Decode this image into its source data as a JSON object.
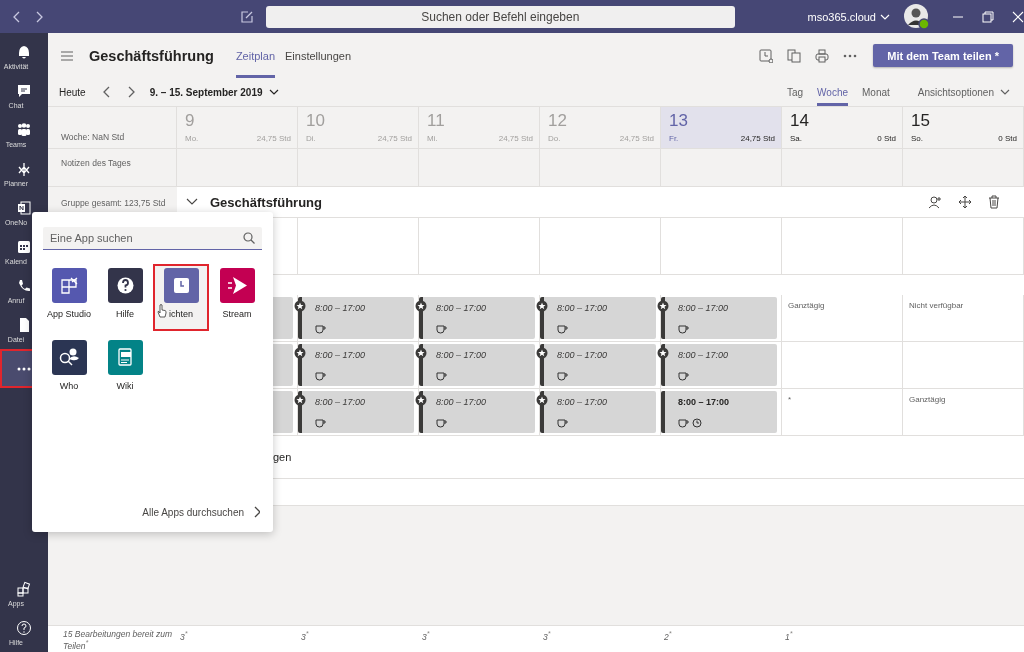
{
  "title_bar": {
    "search_placeholder": "Suchen oder Befehl eingeben",
    "tenant": "mso365.cloud"
  },
  "rail": {
    "items": [
      {
        "label": "Aktivität",
        "selected": false
      },
      {
        "label": "Chat",
        "selected": false
      },
      {
        "label": "Teams",
        "selected": false
      },
      {
        "label": "Planner",
        "selected": false
      },
      {
        "label": "OneNo",
        "selected": false
      },
      {
        "label": "Kalend",
        "selected": false
      },
      {
        "label": "Anruf",
        "selected": false
      },
      {
        "label": "Datei",
        "selected": false
      },
      {
        "selected": true
      }
    ],
    "bottom_items": [
      {
        "label": "Apps",
        "selected": false
      },
      {
        "label": "Hilfe",
        "selected": false
      }
    ]
  },
  "header": {
    "team": "Geschäftsführung",
    "tabs": [
      {
        "label": "Zeitplan",
        "selected": true
      },
      {
        "label": "Einstellungen",
        "selected": false
      }
    ],
    "share_button": "Mit dem Team teilen *"
  },
  "toolbar": {
    "today": "Heute",
    "range": "9. – 15. September 2019",
    "views": [
      {
        "label": "Tag",
        "selected": false
      },
      {
        "label": "Woche",
        "selected": true
      },
      {
        "label": "Monat",
        "selected": false
      }
    ],
    "view_options": "Ansichtsoptionen"
  },
  "schedule": {
    "week_total": "Woche: NaN Std",
    "days": [
      {
        "number": "9",
        "name": "Mo.",
        "hours": "24,75 Std",
        "past": true,
        "selected": false
      },
      {
        "number": "10",
        "name": "Di.",
        "hours": "24,75 Std",
        "past": true,
        "selected": false
      },
      {
        "number": "11",
        "name": "Mi.",
        "hours": "24,75 Std",
        "past": true,
        "selected": false
      },
      {
        "number": "12",
        "name": "Do.",
        "hours": "24,75 Std",
        "past": true,
        "selected": false
      },
      {
        "number": "13",
        "name": "Fr.",
        "hours": "24,75 Std",
        "past": false,
        "selected": true
      },
      {
        "number": "14",
        "name": "Sa.",
        "hours": "0 Std",
        "past": false,
        "selected": false
      },
      {
        "number": "15",
        "name": "So.",
        "hours": "0 Std",
        "past": false,
        "selected": false
      }
    ],
    "notes_label": "Notizen des Tages",
    "group": {
      "total": "Gruppe gesamt: 123,75 Std",
      "name": "Geschäftsführung",
      "expanded": true
    },
    "shift_rows": [
      {
        "cells": [
          {
            "kind": "block"
          },
          {
            "kind": "shift",
            "time": "8:00 – 17:00",
            "edited": true,
            "has_break": true,
            "timed": false
          },
          {
            "kind": "shift",
            "time": "8:00 – 17:00",
            "edited": true,
            "has_break": true,
            "timed": false
          },
          {
            "kind": "shift",
            "time": "8:00 – 17:00",
            "edited": true,
            "has_break": true,
            "timed": false
          },
          {
            "kind": "shift",
            "time": "8:00 – 17:00",
            "edited": true,
            "has_break": true,
            "timed": false
          },
          {
            "kind": "note",
            "text": "Ganztägig"
          },
          {
            "kind": "note",
            "text": "Nicht verfügbar"
          }
        ]
      },
      {
        "cells": [
          {
            "kind": "block"
          },
          {
            "kind": "shift",
            "time": "8:00 – 17:00",
            "edited": true,
            "has_break": true,
            "timed": false
          },
          {
            "kind": "shift",
            "time": "8:00 – 17:00",
            "edited": true,
            "has_break": true,
            "timed": false
          },
          {
            "kind": "shift",
            "time": "8:00 – 17:00",
            "edited": true,
            "has_break": true,
            "timed": false
          },
          {
            "kind": "shift",
            "time": "8:00 – 17:00",
            "edited": true,
            "has_break": true,
            "timed": false
          },
          {
            "kind": "empty"
          },
          {
            "kind": "empty"
          }
        ]
      },
      {
        "cells": [
          {
            "kind": "block"
          },
          {
            "kind": "shift",
            "time": "8:00 – 17:00",
            "edited": true,
            "has_break": true,
            "timed": false
          },
          {
            "kind": "shift",
            "time": "8:00 – 17:00",
            "edited": true,
            "has_break": true,
            "timed": false
          },
          {
            "kind": "shift",
            "time": "8:00 – 17:00",
            "edited": true,
            "has_break": true,
            "timed": false
          },
          {
            "kind": "shift",
            "time": "8:00 – 17:00",
            "edited": false,
            "has_break": true,
            "timed": true
          },
          {
            "kind": "note",
            "text": "*"
          },
          {
            "kind": "note",
            "text": "Ganztägig"
          }
        ]
      }
    ],
    "row_fragment": "gen",
    "footer": {
      "edits": "15 Bearbeitungen bereit zum Teilen$^{*}$",
      "counts": [
        "3$^{*}$",
        "3$^{*}$",
        "3$^{*}$",
        "3$^{*}$",
        "2$^{*}$",
        "1$^{*}$"
      ]
    }
  },
  "apps_popup": {
    "search_placeholder": "Eine App suchen",
    "apps": [
      {
        "label": "App Studio",
        "color": "#5558af",
        "selected": false
      },
      {
        "label": "Hilfe",
        "color": "#33344a",
        "selected": false
      },
      {
        "label": "ichten",
        "color": "#6264a7",
        "selected": true
      },
      {
        "label": "Stream",
        "color": "#c30052",
        "selected": false
      },
      {
        "label": "Who",
        "color": "#2b3553",
        "selected": false
      },
      {
        "label": "Wiki",
        "color": "#038387",
        "selected": false
      }
    ],
    "more": "Alle Apps durchsuchen"
  }
}
